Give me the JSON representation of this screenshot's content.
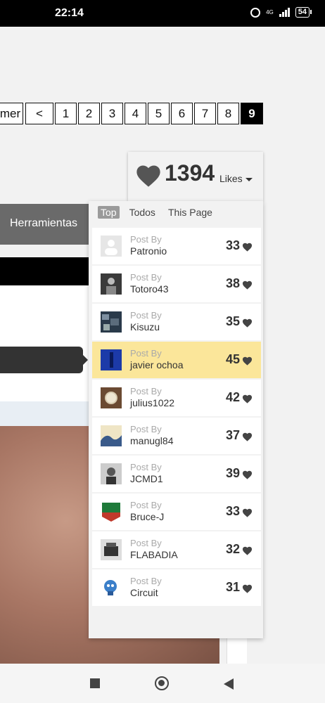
{
  "status": {
    "time": "22:14",
    "network": "4G",
    "battery": "54"
  },
  "pagination": {
    "partial_label": "mer",
    "prev": "<",
    "pages": [
      "1",
      "2",
      "3",
      "4",
      "5",
      "6",
      "7",
      "8",
      "9"
    ],
    "active": "9"
  },
  "menu": {
    "herramientas": "Herramientas"
  },
  "likes": {
    "count": "1394",
    "label": "Likes"
  },
  "tabs": [
    "Top",
    "Todos",
    "This Page"
  ],
  "post_by_label": "Post By",
  "rows": [
    {
      "name": "Patronio",
      "score": "33",
      "avatar": "blank-avatar"
    },
    {
      "name": "Totoro43",
      "score": "38",
      "avatar": "person-avatar"
    },
    {
      "name": "Kisuzu",
      "score": "35",
      "avatar": "mosaic-avatar"
    },
    {
      "name": "javier ochoa",
      "score": "45",
      "avatar": "blue-avatar",
      "highlight": true
    },
    {
      "name": "julius1022",
      "score": "42",
      "avatar": "watch-avatar"
    },
    {
      "name": "manugl84",
      "score": "37",
      "avatar": "wave-avatar"
    },
    {
      "name": "JCMD1",
      "score": "39",
      "avatar": "portrait-avatar"
    },
    {
      "name": "Bruce-J",
      "score": "33",
      "avatar": "badge-avatar"
    },
    {
      "name": "FLABADIA",
      "score": "32",
      "avatar": "typewriter-avatar"
    },
    {
      "name": "Circuit",
      "score": "31",
      "avatar": "skull-avatar"
    }
  ],
  "colors": {
    "highlight": "#fbe69a",
    "active_page": "#000000",
    "heart": "#444444"
  }
}
